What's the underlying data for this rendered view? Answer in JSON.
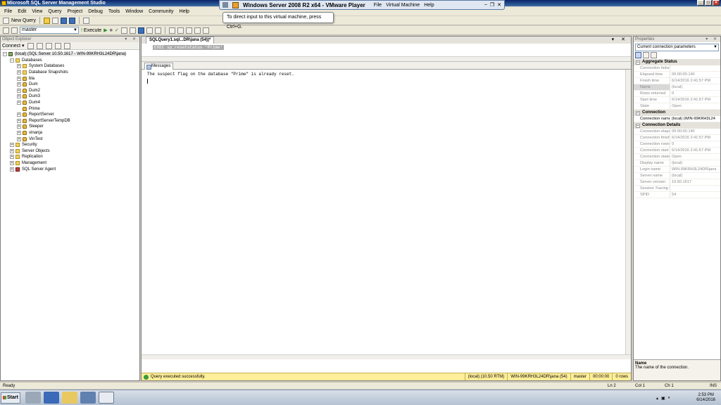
{
  "window": {
    "title": "Microsoft SQL Server Management Studio"
  },
  "menu": [
    "File",
    "Edit",
    "View",
    "Query",
    "Project",
    "Debug",
    "Tools",
    "Window",
    "Community",
    "Help"
  ],
  "toolbar": {
    "new_query": "New Query",
    "database": "master",
    "execute": "Execute"
  },
  "vmware": {
    "title": "Windows Server 2008 R2 x64 - VMware Player",
    "menu": [
      "File",
      "Virtual Machine",
      "Help"
    ],
    "tip": "To direct input to this virtual machine, press Ctrl+G."
  },
  "object_explorer": {
    "title": "Object Explorer",
    "connect": "Connect",
    "server": "(local) (SQL Server 10.50.1617 - WIN-99KRH3L24DR\\jana)",
    "databases_label": "Databases",
    "databases": [
      "System Databases",
      "Database Snapshots",
      "bla",
      "Dum",
      "Dum2",
      "Dum3",
      "Dum4",
      "Prime",
      "ReportServer",
      "ReportServerTempDB",
      "Sleeper",
      "vinanja",
      "VinTest"
    ],
    "other_nodes": [
      "Security",
      "Server Objects",
      "Replication",
      "Management",
      "SQL Server Agent"
    ]
  },
  "editor": {
    "tab": "SQLQuery1.sql...DR\\jana (54))*",
    "query": "EXEC sp_resetstatus 'Prime'",
    "results_tab": "Messages",
    "message": "The suspect flag on the database \"Prime\" is already reset.",
    "status": "Query executed successfully.",
    "status_cells": [
      "(local) (10.50 RTM)",
      "WIN-99KRH3L24DR\\jana (54)",
      "master",
      "00:00:00",
      "0 rows"
    ]
  },
  "properties": {
    "title": "Properties",
    "selector": "Current connection parameters",
    "categories": [
      {
        "name": "Aggregate Status",
        "rows": [
          [
            "Connection failures",
            ""
          ],
          [
            "Elapsed time",
            "00:00:00.140"
          ],
          [
            "Finish time",
            "6/14/2016 2:41:57 PM"
          ],
          [
            "Name",
            "(local)"
          ],
          [
            "Rows returned",
            "0"
          ],
          [
            "Start time",
            "6/14/2016 2:41:57 PM"
          ],
          [
            "State",
            "Open"
          ]
        ]
      },
      {
        "name": "Connection",
        "rows": [
          [
            "Connection name",
            "(local) (WIN-99KRH3L24"
          ]
        ]
      },
      {
        "name": "Connection Details",
        "rows": [
          [
            "Connection elapsed",
            "00:00:00.140"
          ],
          [
            "Connection finish ti",
            "6/14/2016 2:41:57 PM"
          ],
          [
            "Connection rows re",
            "0"
          ],
          [
            "Connection start tir",
            "6/14/2016 2:41:57 PM"
          ],
          [
            "Connection state",
            "Open"
          ],
          [
            "Display name",
            "(local)"
          ],
          [
            "Login name",
            "WIN-99KRH3L24DR\\jana"
          ],
          [
            "Server name",
            "(local)"
          ],
          [
            "Server version",
            "10.50.1617"
          ],
          [
            "Session Tracing ID",
            ""
          ],
          [
            "SPID",
            "54"
          ]
        ]
      }
    ],
    "desc_title": "Name",
    "desc_text": "The name of the connection."
  },
  "statusbar": {
    "left": "Ready",
    "ln": "Ln 2",
    "col": "Col 1",
    "ch": "Ch 1",
    "mode": "INS"
  },
  "taskbar": {
    "start": "Start",
    "time": "2:53 PM",
    "date": "6/14/2016"
  }
}
